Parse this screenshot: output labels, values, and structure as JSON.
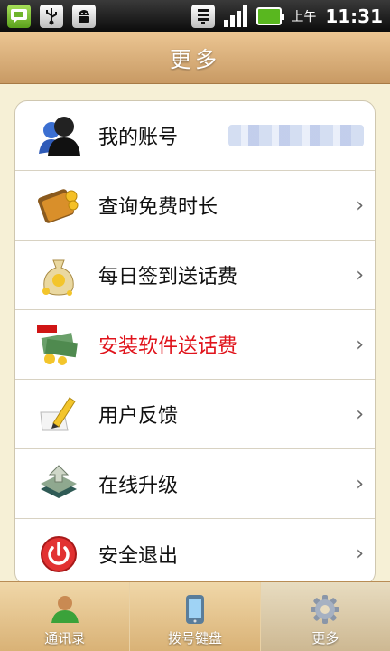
{
  "status_bar": {
    "ampm": "上午",
    "time": "11:31",
    "icons": [
      "android-notification-icon",
      "usb-icon",
      "android-debug-icon",
      "wifi-icon",
      "signal-icon",
      "battery-icon"
    ]
  },
  "header": {
    "title": "更多"
  },
  "menu": {
    "items": [
      {
        "label": "我的账号",
        "icon": "account-icon"
      },
      {
        "label": "查询免费时长",
        "icon": "wallet-icon"
      },
      {
        "label": "每日签到送话费",
        "icon": "money-bag-icon"
      },
      {
        "label": "安装软件送话费",
        "icon": "hot-money-icon",
        "color": "#e0141c"
      },
      {
        "label": "用户反馈",
        "icon": "feedback-pencil-icon"
      },
      {
        "label": "在线升级",
        "icon": "upgrade-icon"
      },
      {
        "label": "安全退出",
        "icon": "power-icon"
      }
    ]
  },
  "tabs": [
    {
      "label": "通讯录",
      "icon": "contacts-icon"
    },
    {
      "label": "拨号键盘",
      "icon": "phone-icon"
    },
    {
      "label": "更多",
      "icon": "gear-icon",
      "active": true
    }
  ],
  "colors": {
    "header": "#d8ad78",
    "background": "#f6f0d6",
    "hot_text": "#e0141c"
  }
}
